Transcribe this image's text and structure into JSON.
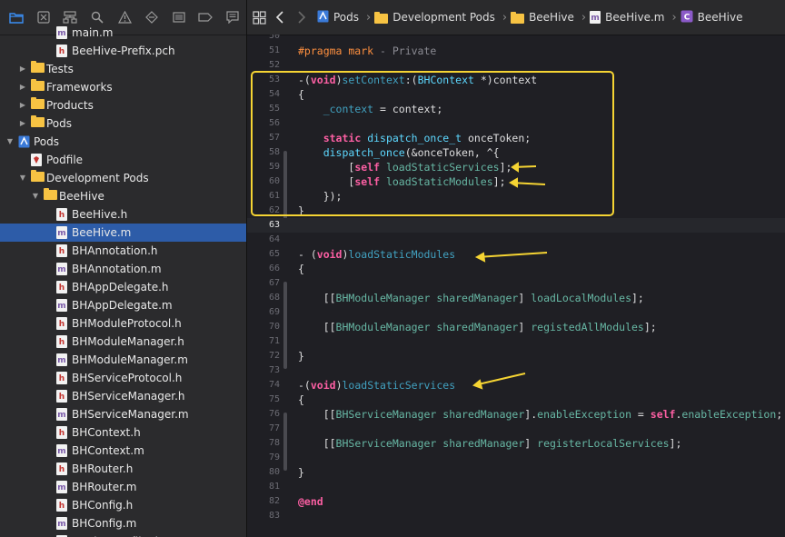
{
  "navigator": {
    "toolbar_icons": [
      "folder-icon",
      "source-control-icon",
      "hierarchy-icon",
      "search-icon",
      "warning-icon",
      "test-icon",
      "debug-icon",
      "breakpoint-icon",
      "report-icon"
    ],
    "items": [
      {
        "label": "main.m",
        "icon": "m",
        "indent": 62,
        "disc": ""
      },
      {
        "label": "BeeHive-Prefix.pch",
        "icon": "h",
        "indent": 62,
        "disc": ""
      },
      {
        "label": "Tests",
        "icon": "folder",
        "indent": 34,
        "disc": "▶"
      },
      {
        "label": "Frameworks",
        "icon": "folder",
        "indent": 34,
        "disc": "▶"
      },
      {
        "label": "Products",
        "icon": "folder",
        "indent": 34,
        "disc": "▶"
      },
      {
        "label": "Pods",
        "icon": "folder",
        "indent": 34,
        "disc": "▶"
      },
      {
        "label": "Pods",
        "icon": "project",
        "indent": 20,
        "disc": "▼"
      },
      {
        "label": "Podfile",
        "icon": "ruby",
        "indent": 34,
        "disc": ""
      },
      {
        "label": "Development Pods",
        "icon": "folder",
        "indent": 34,
        "disc": "▼"
      },
      {
        "label": "BeeHive",
        "icon": "folder",
        "indent": 48,
        "disc": "▼"
      },
      {
        "label": "BeeHive.h",
        "icon": "h",
        "indent": 62,
        "disc": ""
      },
      {
        "label": "BeeHive.m",
        "icon": "m",
        "indent": 62,
        "disc": "",
        "selected": true
      },
      {
        "label": "BHAnnotation.h",
        "icon": "h",
        "indent": 62,
        "disc": ""
      },
      {
        "label": "BHAnnotation.m",
        "icon": "m",
        "indent": 62,
        "disc": ""
      },
      {
        "label": "BHAppDelegate.h",
        "icon": "h",
        "indent": 62,
        "disc": ""
      },
      {
        "label": "BHAppDelegate.m",
        "icon": "m",
        "indent": 62,
        "disc": ""
      },
      {
        "label": "BHModuleProtocol.h",
        "icon": "h",
        "indent": 62,
        "disc": ""
      },
      {
        "label": "BHModuleManager.h",
        "icon": "h",
        "indent": 62,
        "disc": ""
      },
      {
        "label": "BHModuleManager.m",
        "icon": "m",
        "indent": 62,
        "disc": ""
      },
      {
        "label": "BHServiceProtocol.h",
        "icon": "h",
        "indent": 62,
        "disc": ""
      },
      {
        "label": "BHServiceManager.h",
        "icon": "h",
        "indent": 62,
        "disc": ""
      },
      {
        "label": "BHServiceManager.m",
        "icon": "m",
        "indent": 62,
        "disc": ""
      },
      {
        "label": "BHContext.h",
        "icon": "h",
        "indent": 62,
        "disc": ""
      },
      {
        "label": "BHContext.m",
        "icon": "m",
        "indent": 62,
        "disc": ""
      },
      {
        "label": "BHRouter.h",
        "icon": "h",
        "indent": 62,
        "disc": ""
      },
      {
        "label": "BHRouter.m",
        "icon": "m",
        "indent": 62,
        "disc": ""
      },
      {
        "label": "BHConfig.h",
        "icon": "h",
        "indent": 62,
        "disc": ""
      },
      {
        "label": "BHConfig.m",
        "icon": "m",
        "indent": 62,
        "disc": ""
      },
      {
        "label": "BHTimeProfiler.h",
        "icon": "h",
        "indent": 62,
        "disc": ""
      }
    ]
  },
  "jumpbar": {
    "items": [
      {
        "label": "Pods",
        "icon": "project"
      },
      {
        "label": "Development Pods",
        "icon": "folder"
      },
      {
        "label": "BeeHive",
        "icon": "folder"
      },
      {
        "label": "BeeHive.m",
        "icon": "m"
      },
      {
        "label": "BeeHive",
        "icon": "class"
      }
    ]
  },
  "code": {
    "current_line": 63,
    "lines": [
      {
        "n": 50,
        "seg": []
      },
      {
        "n": 51,
        "seg": [
          [
            "prag",
            "#pragma mark"
          ],
          [
            "com",
            " - Private"
          ]
        ]
      },
      {
        "n": 52,
        "seg": []
      },
      {
        "n": 53,
        "seg": [
          [
            "",
            "-("
          ],
          [
            "kw",
            "void"
          ],
          [
            "",
            ")"
          ],
          [
            "ivar",
            "setContext"
          ],
          [
            "",
            ":("
          ],
          [
            "typ",
            "BHContext"
          ],
          [
            "",
            " *)context"
          ]
        ]
      },
      {
        "n": 54,
        "seg": [
          [
            "",
            "{"
          ]
        ]
      },
      {
        "n": 55,
        "seg": [
          [
            "",
            "    "
          ],
          [
            "ivar",
            "_context"
          ],
          [
            "",
            " = context;"
          ]
        ]
      },
      {
        "n": 56,
        "seg": []
      },
      {
        "n": 57,
        "seg": [
          [
            "",
            "    "
          ],
          [
            "kw",
            "static"
          ],
          [
            "",
            " "
          ],
          [
            "typ",
            "dispatch_once_t"
          ],
          [
            "",
            " onceToken;"
          ]
        ]
      },
      {
        "n": 58,
        "seg": [
          [
            "",
            "    "
          ],
          [
            "typ",
            "dispatch_once"
          ],
          [
            "",
            "(&onceToken, ^{"
          ]
        ]
      },
      {
        "n": 59,
        "seg": [
          [
            "",
            "        ["
          ],
          [
            "kw",
            "self"
          ],
          [
            "",
            " "
          ],
          [
            "proj",
            "loadStaticServices"
          ],
          [
            "",
            "];"
          ]
        ]
      },
      {
        "n": 60,
        "seg": [
          [
            "",
            "        ["
          ],
          [
            "kw",
            "self"
          ],
          [
            "",
            " "
          ],
          [
            "proj",
            "loadStaticModules"
          ],
          [
            "",
            "];"
          ]
        ]
      },
      {
        "n": 61,
        "seg": [
          [
            "",
            "    });"
          ]
        ]
      },
      {
        "n": 62,
        "seg": [
          [
            "",
            "}"
          ]
        ]
      },
      {
        "n": 63,
        "seg": []
      },
      {
        "n": 64,
        "seg": []
      },
      {
        "n": 65,
        "seg": [
          [
            "",
            "- ("
          ],
          [
            "kw",
            "void"
          ],
          [
            "",
            ")"
          ],
          [
            "ivar",
            "loadStaticModules"
          ]
        ]
      },
      {
        "n": 66,
        "seg": [
          [
            "",
            "{"
          ]
        ]
      },
      {
        "n": 67,
        "seg": []
      },
      {
        "n": 68,
        "seg": [
          [
            "",
            "    [["
          ],
          [
            "proj",
            "BHModuleManager"
          ],
          [
            "",
            " "
          ],
          [
            "proj",
            "sharedManager"
          ],
          [
            "",
            "] "
          ],
          [
            "proj",
            "loadLocalModules"
          ],
          [
            "",
            "];"
          ]
        ]
      },
      {
        "n": 69,
        "seg": []
      },
      {
        "n": 70,
        "seg": [
          [
            "",
            "    [["
          ],
          [
            "proj",
            "BHModuleManager"
          ],
          [
            "",
            " "
          ],
          [
            "proj",
            "sharedManager"
          ],
          [
            "",
            "] "
          ],
          [
            "proj",
            "registedAllModules"
          ],
          [
            "",
            "];"
          ]
        ]
      },
      {
        "n": 71,
        "seg": []
      },
      {
        "n": 72,
        "seg": [
          [
            "",
            "}"
          ]
        ]
      },
      {
        "n": 73,
        "seg": []
      },
      {
        "n": 74,
        "seg": [
          [
            "",
            "-("
          ],
          [
            "kw",
            "void"
          ],
          [
            "",
            ")"
          ],
          [
            "ivar",
            "loadStaticServices"
          ]
        ]
      },
      {
        "n": 75,
        "seg": [
          [
            "",
            "{"
          ]
        ]
      },
      {
        "n": 76,
        "seg": [
          [
            "",
            "    [["
          ],
          [
            "proj",
            "BHServiceManager"
          ],
          [
            "",
            " "
          ],
          [
            "proj",
            "sharedManager"
          ],
          [
            "",
            "]."
          ],
          [
            "proj",
            "enableException"
          ],
          [
            "",
            " = "
          ],
          [
            "kw",
            "self"
          ],
          [
            "",
            "."
          ],
          [
            "proj",
            "enableException"
          ],
          [
            "",
            ";"
          ]
        ]
      },
      {
        "n": 77,
        "seg": []
      },
      {
        "n": 78,
        "seg": [
          [
            "",
            "    [["
          ],
          [
            "proj",
            "BHServiceManager"
          ],
          [
            "",
            " "
          ],
          [
            "proj",
            "sharedManager"
          ],
          [
            "",
            "] "
          ],
          [
            "proj",
            "registerLocalServices"
          ],
          [
            "",
            "];"
          ]
        ]
      },
      {
        "n": 79,
        "seg": []
      },
      {
        "n": 80,
        "seg": [
          [
            "",
            "}"
          ]
        ]
      },
      {
        "n": 81,
        "seg": []
      },
      {
        "n": 82,
        "seg": [
          [
            "kw",
            "@end"
          ]
        ]
      },
      {
        "n": 83,
        "seg": []
      }
    ]
  },
  "colors": {
    "annotation": "#f5d433",
    "selection": "#2d5ca8",
    "folder": "#f7c343"
  }
}
